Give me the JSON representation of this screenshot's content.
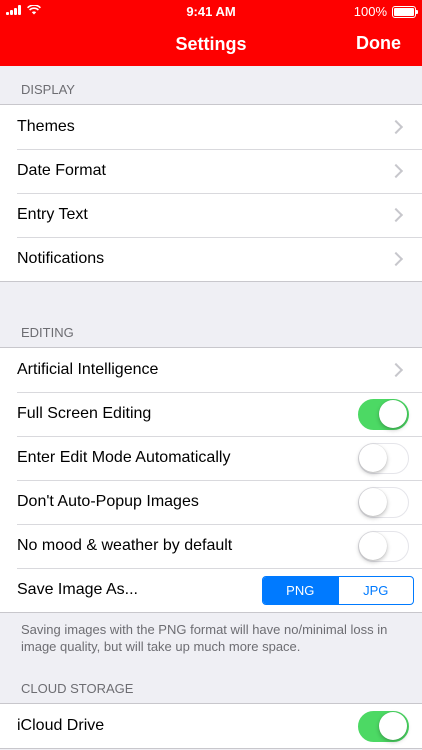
{
  "status": {
    "time": "9:41 AM",
    "battery": "100%"
  },
  "nav": {
    "title": "Settings",
    "done_label": "Done"
  },
  "display": {
    "header": "DISPLAY",
    "items": [
      {
        "label": "Themes"
      },
      {
        "label": "Date Format"
      },
      {
        "label": "Entry Text"
      },
      {
        "label": "Notifications"
      }
    ]
  },
  "editing": {
    "header": "EDITING",
    "ai_label": "Artificial Intelligence",
    "full_screen": {
      "label": "Full Screen Editing",
      "on": true
    },
    "auto_edit": {
      "label": "Enter Edit Mode Automatically",
      "on": false
    },
    "auto_popup": {
      "label": "Don't Auto-Popup Images",
      "on": false
    },
    "no_mood": {
      "label": "No mood & weather by default",
      "on": false
    },
    "save_image": {
      "label": "Save Image As...",
      "options": [
        "PNG",
        "JPG"
      ],
      "selected": "PNG"
    },
    "footer": "Saving images with the PNG format will have no/minimal loss in image quality, but will take up much more space."
  },
  "cloud": {
    "header": "CLOUD STORAGE",
    "icloud": {
      "label": "iCloud Drive",
      "on": true
    }
  },
  "colors": {
    "header_red": "#fe0000",
    "toggle_on": "#4cd964",
    "tint_blue": "#007aff"
  }
}
